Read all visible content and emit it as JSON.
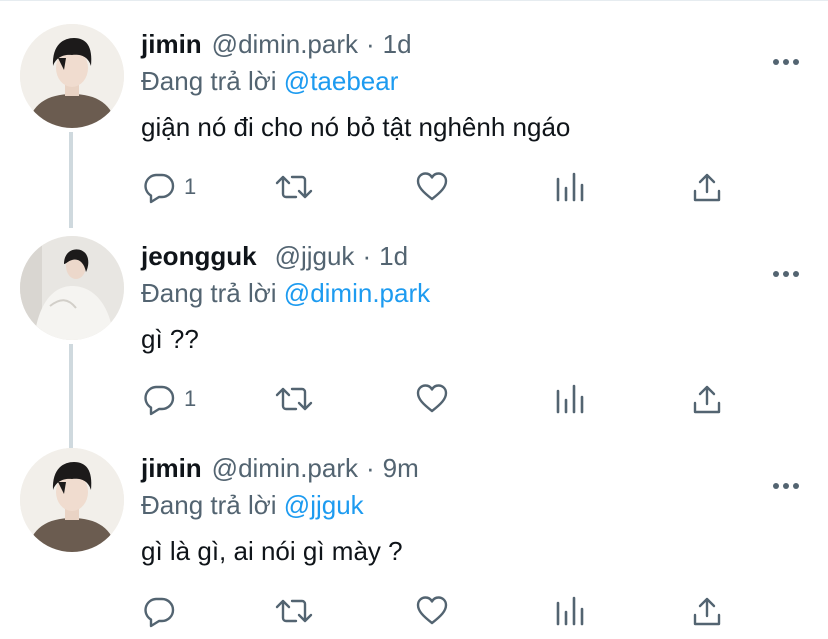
{
  "tweets": [
    {
      "name": "jimin",
      "handle": "@dimin.park",
      "separator": "·",
      "time": "1d",
      "reply_prefix": "Đang trả lời",
      "reply_to": "@taebear",
      "text": "giận nó đi cho nó bỏ tật nghênh ngáo",
      "reply_count": "1",
      "avatar": "jimin-avatar"
    },
    {
      "name": "jeongguk",
      "handle": "@jjguk",
      "separator": "·",
      "time": "1d",
      "reply_prefix": "Đang trả lời",
      "reply_to": "@dimin.park",
      "text": "gì ??",
      "reply_count": "1",
      "avatar": "jeongguk-avatar"
    },
    {
      "name": "jimin",
      "handle": "@dimin.park",
      "separator": "·",
      "time": "9m",
      "reply_prefix": "Đang trả lời",
      "reply_to": "@jjguk",
      "text": "gì là gì, ai nói gì mày ?",
      "reply_count": "",
      "avatar": "jimin-avatar"
    }
  ],
  "icons": {
    "reply": "reply-icon",
    "retweet": "retweet-icon",
    "like": "heart-icon",
    "views": "analytics-icon",
    "share": "share-icon",
    "more": "more-icon"
  },
  "colors": {
    "mention": "#1d9bf0",
    "secondary_text": "#536471",
    "primary_text": "#0f1419",
    "thread_line": "#cfd9de"
  }
}
